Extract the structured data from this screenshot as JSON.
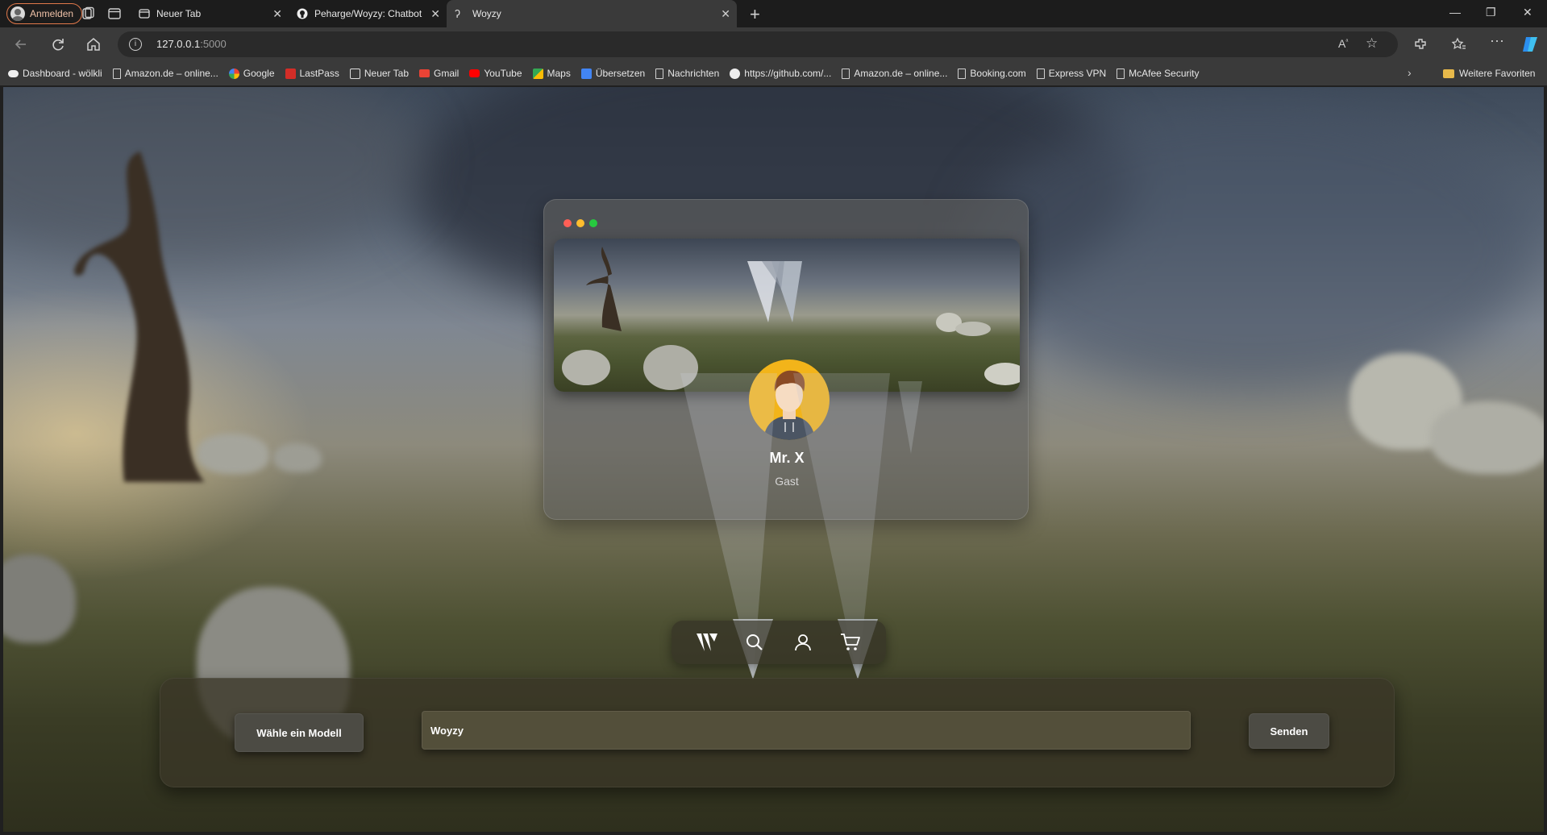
{
  "browser": {
    "profile_label": "Anmelden",
    "tabs": [
      {
        "title": "Neuer Tab",
        "favicon": "newtab-icon"
      },
      {
        "title": "Peharge/Woyzy: Chatbot",
        "favicon": "github-icon"
      },
      {
        "title": "Woyzy",
        "favicon": "woyzy-icon",
        "active": true
      }
    ],
    "url_host": "127.0.0.1",
    "url_port": ":5000",
    "bookmarks": [
      {
        "label": "Dashboard - wölkli",
        "icon": "cloud-icon"
      },
      {
        "label": "Amazon.de – online...",
        "icon": "document-icon"
      },
      {
        "label": "Google",
        "icon": "google-icon"
      },
      {
        "label": "LastPass",
        "icon": "lastpass-icon"
      },
      {
        "label": "Neuer Tab",
        "icon": "newtab-icon"
      },
      {
        "label": "Gmail",
        "icon": "gmail-icon"
      },
      {
        "label": "YouTube",
        "icon": "youtube-icon"
      },
      {
        "label": "Maps",
        "icon": "maps-icon"
      },
      {
        "label": "Übersetzen",
        "icon": "translate-icon"
      },
      {
        "label": "Nachrichten",
        "icon": "document-icon"
      },
      {
        "label": "https://github.com/...",
        "icon": "github-icon"
      },
      {
        "label": "Amazon.de – online...",
        "icon": "document-icon"
      },
      {
        "label": "Booking.com",
        "icon": "document-icon"
      },
      {
        "label": "Express VPN",
        "icon": "document-icon"
      },
      {
        "label": "McAfee Security",
        "icon": "document-icon"
      }
    ],
    "other_favorites": "Weitere Favoriten"
  },
  "profile_card": {
    "name": "Mr. X",
    "role": "Gast",
    "window_dots": [
      "#ff5f56",
      "#ffbd2e",
      "#27c93f"
    ]
  },
  "dock": {
    "items": [
      "woyzy-logo-icon",
      "search-icon",
      "user-icon",
      "cart-icon"
    ]
  },
  "chat": {
    "model_button": "Wähle ein Modell",
    "input_value": "Woyzy",
    "send_button": "Senden"
  }
}
